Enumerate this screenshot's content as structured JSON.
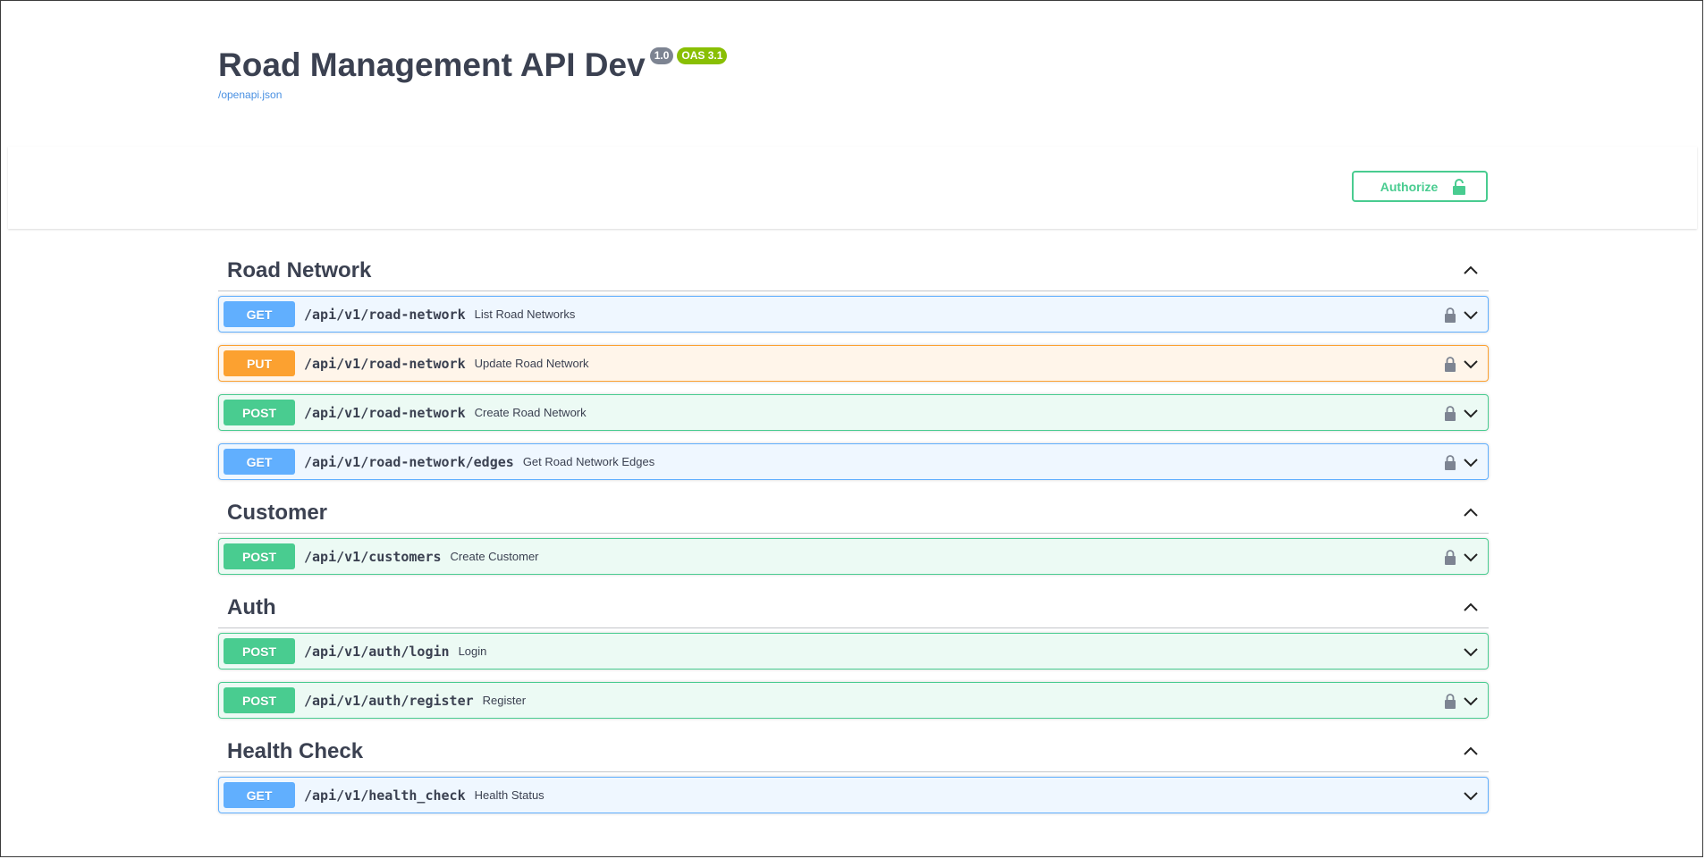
{
  "info": {
    "title": "Road Management API Dev",
    "version": "1.0",
    "oas": "OAS 3.1",
    "spec_link": "/openapi.json"
  },
  "authorize": {
    "label": "Authorize"
  },
  "colors": {
    "get": "#61affe",
    "put": "#fca130",
    "post": "#49cc90",
    "text": "#3b4151"
  },
  "tags": [
    {
      "name": "Road Network",
      "operations": [
        {
          "method": "GET",
          "path": "/api/v1/road-network",
          "summary": "List Road Networks",
          "locked": true
        },
        {
          "method": "PUT",
          "path": "/api/v1/road-network",
          "summary": "Update Road Network",
          "locked": true
        },
        {
          "method": "POST",
          "path": "/api/v1/road-network",
          "summary": "Create Road Network",
          "locked": true
        },
        {
          "method": "GET",
          "path": "/api/v1/road-network/edges",
          "summary": "Get Road Network Edges",
          "locked": true
        }
      ]
    },
    {
      "name": "Customer",
      "operations": [
        {
          "method": "POST",
          "path": "/api/v1/customers",
          "summary": "Create Customer",
          "locked": true
        }
      ]
    },
    {
      "name": "Auth",
      "operations": [
        {
          "method": "POST",
          "path": "/api/v1/auth/login",
          "summary": "Login",
          "locked": false
        },
        {
          "method": "POST",
          "path": "/api/v1/auth/register",
          "summary": "Register",
          "locked": true
        }
      ]
    },
    {
      "name": "Health Check",
      "operations": [
        {
          "method": "GET",
          "path": "/api/v1/health_check",
          "summary": "Health Status",
          "locked": false
        }
      ]
    }
  ]
}
